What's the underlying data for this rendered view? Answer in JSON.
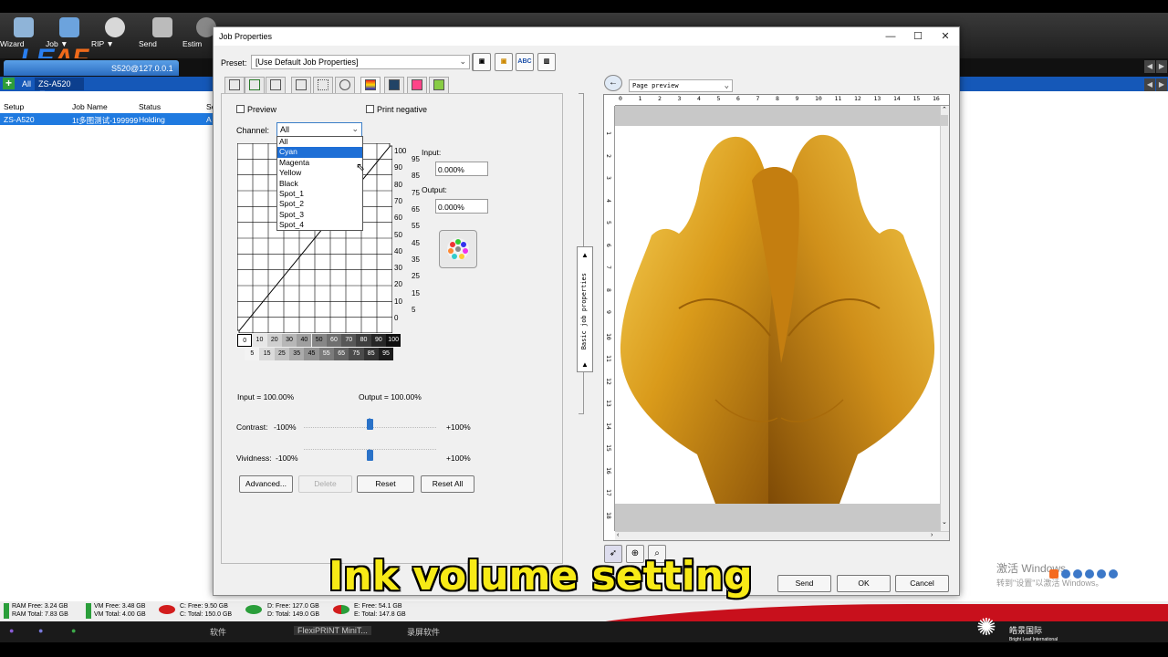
{
  "toolbar": {
    "wizard": "Wizard",
    "job": "Job ▼",
    "rip": "RIP ▼",
    "send": "Send",
    "estimate": "Estim"
  },
  "logo": {
    "left": "LE",
    "right": "AF"
  },
  "connection_tab": "S520@127.0.0.1",
  "queue": {
    "plus": "+",
    "all": "All",
    "printer": "ZS-A520 ▼"
  },
  "list": {
    "headers": [
      "Setup",
      "Job Name",
      "Status",
      "Se"
    ],
    "row": [
      "ZS-A520",
      "1t多图测试-199999",
      "Holding",
      "A"
    ]
  },
  "status": {
    "ram_free": "RAM Free: 3.24 GB",
    "ram_total": "RAM Total: 7.83 GB",
    "vm_free": "VM Free: 3.48 GB",
    "vm_total": "VM Total: 4.00 GB",
    "c_free": "C: Free: 9.50 GB",
    "c_total": "C: Total: 150.0 GB",
    "d_free": "D: Free: 127.0 GB",
    "d_total": "D: Total: 149.0 GB",
    "e_free": "E: Free: 54.1 GB",
    "e_total": "E: Total: 147.8 GB"
  },
  "taskbar": {
    "item1": "软件",
    "item2": "FlexiPRINT MiniT...",
    "item3": "录屏软件"
  },
  "activation": {
    "line1": "激活 Windows",
    "line2": "转到\"设置\"以激活 Windows。"
  },
  "bottom_logo": {
    "name": "皓景国际",
    "sub": "Bright Leaf International"
  },
  "dialog": {
    "title": "Job Properties",
    "preset_label": "Preset:",
    "preset_value": "[Use Default Job Properties]",
    "abc_button": "ABC",
    "preview_checkbox": "Preview",
    "print_negative_checkbox": "Print negative",
    "channel_label": "Channel:",
    "channel_value": "All",
    "channel_options": [
      "All",
      "Cyan",
      "Magenta",
      "Yellow",
      "Black",
      "Spot_1",
      "Spot_2",
      "Spot_3",
      "Spot_4"
    ],
    "selected_option": "Cyan",
    "y_labels_left": [
      "100",
      "90",
      "80",
      "70",
      "60",
      "50",
      "40",
      "30",
      "20",
      "10",
      "0"
    ],
    "y_labels_right": [
      "95",
      "85",
      "75",
      "65",
      "55",
      "45",
      "35",
      "25",
      "15",
      "5"
    ],
    "input_label": "Input:",
    "input_value": "0.000%",
    "output_label": "Output:",
    "output_value": "0.000%",
    "grey_top": [
      "0",
      "10",
      "20",
      "30",
      "40",
      "50",
      "60",
      "70",
      "80",
      "90",
      "100"
    ],
    "grey_bottom": [
      "5",
      "15",
      "25",
      "35",
      "45",
      "55",
      "65",
      "75",
      "85",
      "95"
    ],
    "input_readout": "Input = 100.00%",
    "output_readout": "Output = 100.00%",
    "contrast_label": "Contrast:",
    "contrast_min": "-100%",
    "contrast_max": "+100%",
    "contrast_value": 0,
    "vividness_label": "Vividness:",
    "vividness_min": "-100%",
    "vividness_max": "+100%",
    "vividness_value": 0,
    "advanced_button": "Advanced...",
    "delete_button": "Delete",
    "reset_button": "Reset",
    "reset_all_button": "Reset All",
    "basic_tab": "Basic job properties",
    "page_preview": "Page preview",
    "ruler_h": [
      "0",
      "1",
      "2",
      "3",
      "4",
      "5",
      "6",
      "7",
      "8",
      "9",
      "10",
      "11",
      "12",
      "13",
      "14",
      "15",
      "16"
    ],
    "ruler_v": [
      "1",
      "2",
      "3",
      "4",
      "5",
      "6",
      "7",
      "8",
      "9",
      "10",
      "11",
      "12",
      "13",
      "14",
      "15",
      "16",
      "17",
      "18"
    ],
    "send_button": "Send",
    "ok_button": "OK",
    "cancel_button": "Cancel"
  },
  "subtitle": "Ink volume setting"
}
